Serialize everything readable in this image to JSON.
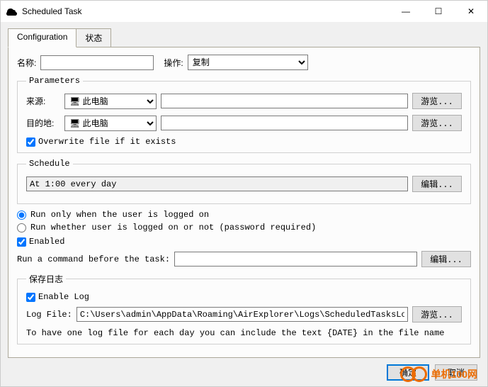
{
  "window": {
    "title": "Scheduled Task"
  },
  "winctrl": {
    "min": "—",
    "max": "☐",
    "close": "✕"
  },
  "tabs": {
    "config": "Configuration",
    "status": "状态"
  },
  "topRow": {
    "nameLabel": "名称:",
    "nameValue": "",
    "opLabel": "操作:",
    "opSelected": "复制"
  },
  "params": {
    "legend": "Parameters",
    "sourceLabel": "来源:",
    "sourceCombo": "此电脑",
    "sourcePath": "",
    "destLabel": "目的地:",
    "destCombo": "此电脑",
    "destPath": "",
    "browse": "游览...",
    "overwrite": "Overwrite file if it exists"
  },
  "schedule": {
    "legend": "Schedule",
    "text": "At 1:00 every day",
    "edit": "编辑..."
  },
  "runOpts": {
    "loggedOn": "Run only when the user is logged on",
    "whether": "Run whether user is logged on or not (password required)",
    "enabled": "Enabled",
    "cmdLabel": "Run a command before the task:",
    "cmdValue": "",
    "edit": "编辑..."
  },
  "log": {
    "legend": "保存日志",
    "enable": "Enable Log",
    "fileLabel": "Log File:",
    "fileValue": "C:\\Users\\admin\\AppData\\Roaming\\AirExplorer\\Logs\\ScheduledTasksLog-{DATE}.txt",
    "browse": "游览...",
    "hint": "To have one log file for each day you can include the text {DATE} in the file name"
  },
  "buttons": {
    "ok": "确定",
    "cancel": "取消"
  },
  "watermark": "单机100网"
}
